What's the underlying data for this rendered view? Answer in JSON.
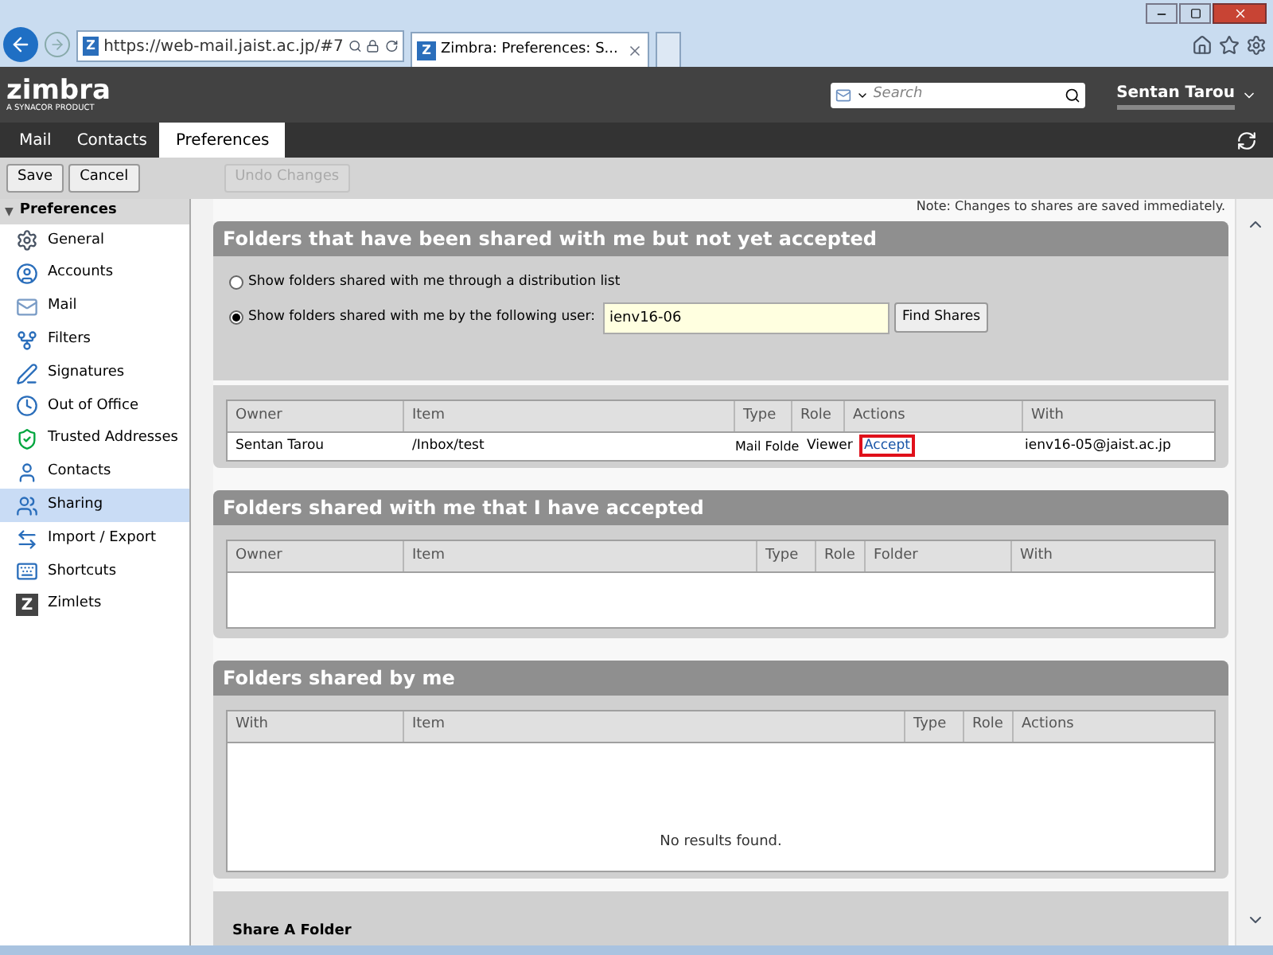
{
  "browser": {
    "site_icon": "Z",
    "url": "https://web-mail.jaist.ac.jp/#7",
    "tabs": [
      {
        "icon_letter": "Z",
        "label": "Zimbra: Preferences: S...",
        "selected": true
      }
    ]
  },
  "header": {
    "logo": "zimbra",
    "logo_sub": "A SYNACOR PRODUCT",
    "search_placeholder": "Search",
    "user": "Sentan Tarou"
  },
  "app_tabs": [
    {
      "label": "Mail",
      "selected": false
    },
    {
      "label": "Contacts",
      "selected": false
    },
    {
      "label": "Preferences",
      "selected": true
    }
  ],
  "toolbar": [
    {
      "label": "Save",
      "disabled": false
    },
    {
      "label": "Cancel",
      "disabled": false
    },
    {
      "label": "Undo Changes",
      "disabled": true
    }
  ],
  "sidebar": {
    "toggle": "▼",
    "title": "Preferences",
    "items": [
      {
        "label": "General",
        "selected": false
      },
      {
        "label": "Accounts",
        "selected": false
      },
      {
        "label": "Mail",
        "selected": false
      },
      {
        "label": "Filters",
        "selected": false
      },
      {
        "label": "Signatures",
        "selected": false
      },
      {
        "label": "Out of Office",
        "selected": false
      },
      {
        "label": "Trusted Addresses",
        "selected": false
      },
      {
        "label": "Contacts",
        "selected": false
      },
      {
        "label": "Sharing",
        "selected": true
      },
      {
        "label": "Import / Export",
        "selected": false
      },
      {
        "label": "Shortcuts",
        "selected": false
      },
      {
        "label": "Zimlets",
        "icon_letter": "Z",
        "selected": false
      }
    ]
  },
  "note": "Note: Changes to shares are saved immediately.",
  "pending": {
    "title": "Folders that have been shared with me but not yet accepted",
    "options": [
      {
        "label": "Show folders shared with me through a distribution list",
        "selected": false
      },
      {
        "label": "Show folders shared with me by the following user:",
        "selected": true
      }
    ],
    "user_value": "ienv16-06",
    "find_button": "Find Shares",
    "columns": [
      "Owner",
      "Item",
      "Type",
      "Role",
      "Actions",
      "With"
    ],
    "rows": [
      {
        "owner": "Sentan Tarou",
        "item": "/Inbox/test",
        "type": "Mail Folde",
        "role": "Viewer",
        "action": "Accept",
        "with": "ienv16-05@jaist.ac.jp"
      }
    ]
  },
  "accepted": {
    "title": "Folders shared with me that I have accepted",
    "columns": [
      "Owner",
      "Item",
      "Type",
      "Role",
      "Folder",
      "With"
    ]
  },
  "by_me": {
    "title": "Folders shared by me",
    "columns": [
      "With",
      "Item",
      "Type",
      "Role",
      "Actions"
    ],
    "empty": "No results found."
  },
  "share_folder": {
    "title": "Share A Folder"
  }
}
